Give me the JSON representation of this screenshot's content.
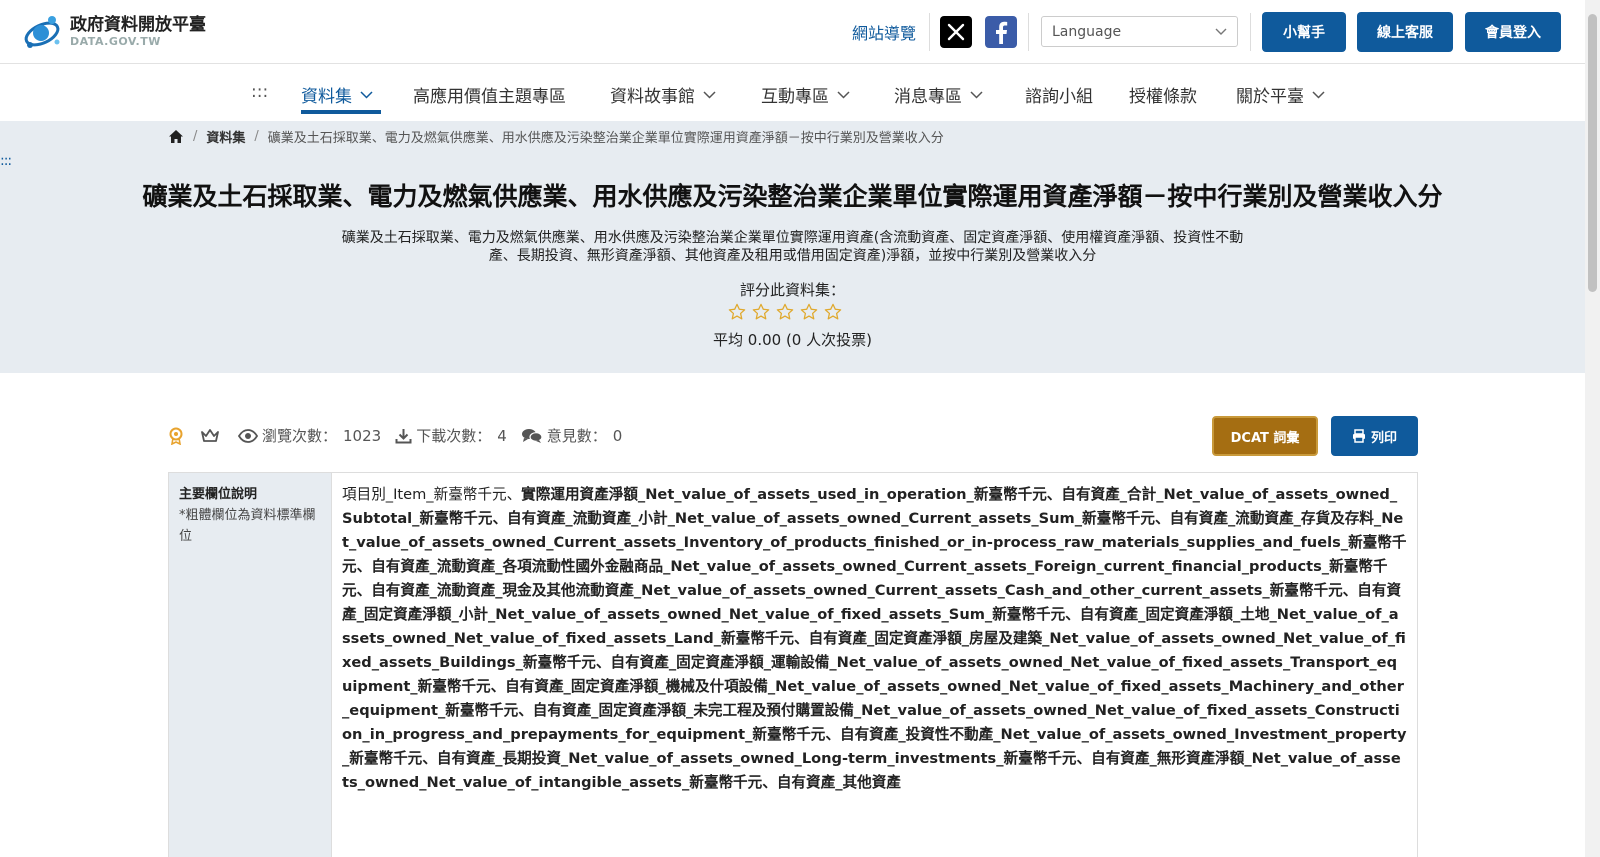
{
  "header": {
    "logo_cn": "政府資料開放平臺",
    "logo_en": "DATA.GOV.TW",
    "sitemap_label": "網站導覽",
    "language_placeholder": "Language",
    "buttons": {
      "helper": "小幫手",
      "support": "線上客服",
      "login": "會員登入"
    }
  },
  "nav": {
    "dots": ":::",
    "items": [
      {
        "label": "資料集"
      },
      {
        "label": "高應用價值主題專區"
      },
      {
        "label": "資料故事館"
      },
      {
        "label": "互動專區"
      },
      {
        "label": "消息專區"
      },
      {
        "label": "諮詢小組"
      },
      {
        "label": "授權條款"
      },
      {
        "label": "關於平臺"
      }
    ]
  },
  "breadcrumb": {
    "section": "資料集",
    "current": "礦業及土石採取業、電力及燃氣供應業、用水供應及污染整治業企業單位實際運用資產淨額－按中行業別及營業收入分"
  },
  "dataset": {
    "anchor_dots": ":::",
    "title": "礦業及土石採取業、電力及燃氣供應業、用水供應及污染整治業企業單位實際運用資產淨額－按中行業別及營業收入分",
    "description": "礦業及土石採取業、電力及燃氣供應業、用水供應及污染整治業企業單位實際運用資產(含流動資產、固定資產淨額、使用權資產淨額、投資性不動產、長期投資、無形資產淨額、其他資產及租用或借用固定資產)淨額，並按中行業別及營業收入分",
    "rating_label": "評分此資料集：",
    "rating_value": 0,
    "rating_max": 5,
    "rating_avg": "平均 0.00 (0 人次投票)"
  },
  "stats": {
    "views_label": "瀏覽次數：",
    "views": "1023",
    "downloads_label": "下載次數：",
    "downloads": "4",
    "comments_label": "意見數：",
    "comments": "0"
  },
  "actions": {
    "dcat": "DCAT 詞彙",
    "print": "列印"
  },
  "fields": {
    "label_title": "主要欄位說明",
    "label_note": "*粗體欄位為資料標準欄位",
    "content_plain_1": "項目別_Item_新臺幣千元、",
    "content_bold": "實際運用資產淨額_Net_value_of_assets_used_in_operation_新臺幣千元、自有資產_合計_Net_value_of_assets_owned_Subtotal_新臺幣千元、自有資產_流動資產_小計_Net_value_of_assets_owned_Current_assets_Sum_新臺幣千元、自有資產_流動資產_存貨及存料_Net_value_of_assets_owned_Current_assets_Inventory_of_products_finished_or_in-process_raw_materials_supplies_and_fuels_新臺幣千元、自有資產_流動資產_各項流動性國外金融商品_Net_value_of_assets_owned_Current_assets_Foreign_current_financial_products_新臺幣千元、自有資產_流動資產_現金及其他流動資產_Net_value_of_assets_owned_Current_assets_Cash_and_other_current_assets_新臺幣千元、自有資產_固定資產淨額_小計_Net_value_of_assets_owned_Net_value_of_fixed_assets_Sum_新臺幣千元、自有資產_固定資產淨額_土地_Net_value_of_assets_owned_Net_value_of_fixed_assets_Land_新臺幣千元、自有資產_固定資產淨額_房屋及建築_Net_value_of_assets_owned_Net_value_of_fixed_assets_Buildings_新臺幣千元、自有資產_固定資產淨額_運輸設備_Net_value_of_assets_owned_Net_value_of_fixed_assets_Transport_equipment_新臺幣千元、自有資產_固定資產淨額_機械及什項設備_Net_value_of_assets_owned_Net_value_of_fixed_assets_Machinery_and_other_equipment_新臺幣千元、自有資產_固定資產淨額_未完工程及預付購置設備_Net_value_of_assets_owned_Net_value_of_fixed_assets_Construction_in_progress_and_prepayments_for_equipment_新臺幣千元、自有資產_投資性不動產_Net_value_of_assets_owned_Investment_property_新臺幣千元、自有資產_長期投資_Net_value_of_assets_owned_Long-term_investments_新臺幣千元、自有資產_無形資產淨額_Net_value_of_assets_owned_Net_value_of_intangible_assets_新臺幣千元、自有資產_其他資產"
  },
  "colors": {
    "brand_blue": "#0f5a9c",
    "dcat_gold": "#a56e12",
    "hero_bg": "#e7ecf1",
    "star_outline": "#e0a92e"
  }
}
